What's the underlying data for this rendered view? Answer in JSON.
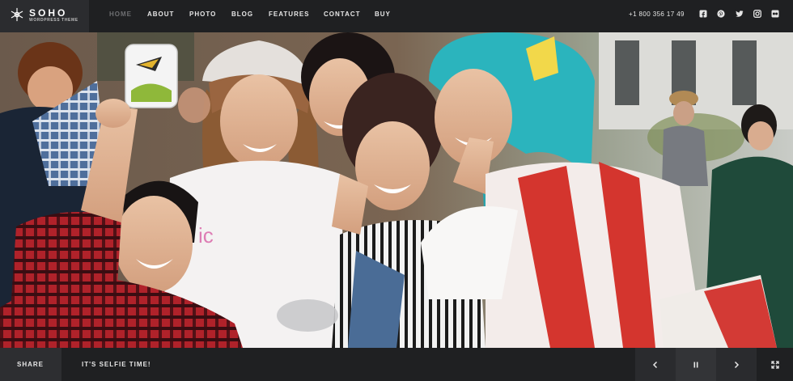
{
  "logo": {
    "name": "SOHO",
    "tagline": "WORDPRESS THEME",
    "icon": "snowflake-logo-icon"
  },
  "nav": {
    "items": [
      {
        "label": "HOME",
        "active": true
      },
      {
        "label": "ABOUT",
        "active": false
      },
      {
        "label": "PHOTO",
        "active": false
      },
      {
        "label": "BLOG",
        "active": false
      },
      {
        "label": "FEATURES",
        "active": false
      },
      {
        "label": "CONTACT",
        "active": false
      },
      {
        "label": "BUY",
        "active": false
      }
    ],
    "active_color": "#6e6f72",
    "text_color": "#e6e6e6"
  },
  "phone": "+1 800 356 17 49",
  "social_icons": [
    "facebook-icon",
    "pinterest-icon",
    "twitter-icon",
    "instagram-icon",
    "flickr-icon"
  ],
  "hero": {
    "subject": "cosplay-selfie-photo"
  },
  "bottom_bar": {
    "share_label": "SHARE",
    "caption": "IT'S SELFIE TIME!",
    "controls": [
      "prev-arrow-icon",
      "pause-icon",
      "next-arrow-icon",
      "fullscreen-icon"
    ]
  },
  "colors": {
    "bar_bg": "#1f2022",
    "logo_bg": "#2b2c2f",
    "share_bg": "#2d2e31"
  }
}
